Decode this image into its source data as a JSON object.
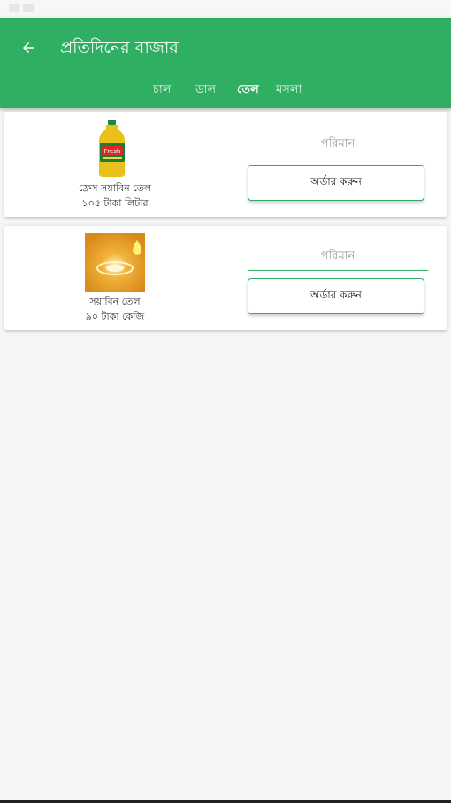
{
  "app": {
    "title": "প্রতিদিনের বাজার"
  },
  "tabs": [
    {
      "label": "চাল",
      "active": false
    },
    {
      "label": "ডাল",
      "active": false
    },
    {
      "label": "তেল",
      "active": true
    },
    {
      "label": "মসলা",
      "active": false
    }
  ],
  "products": [
    {
      "name": "ফ্রেস সয়াবিন তেল",
      "price": "১০৫ টাকা লিটার",
      "image": "oil-bottle-image",
      "quantity_placeholder": "পরিমান",
      "order_label": "অর্ডার করুন"
    },
    {
      "name": "সয়াবিন তেল",
      "price": "৯০ টাকা কেজি",
      "image": "oil-drop-image",
      "quantity_placeholder": "পরিমান",
      "order_label": "অর্ডার করুন"
    }
  ],
  "colors": {
    "primary": "#2eaf62",
    "background": "#f5f5f5"
  }
}
